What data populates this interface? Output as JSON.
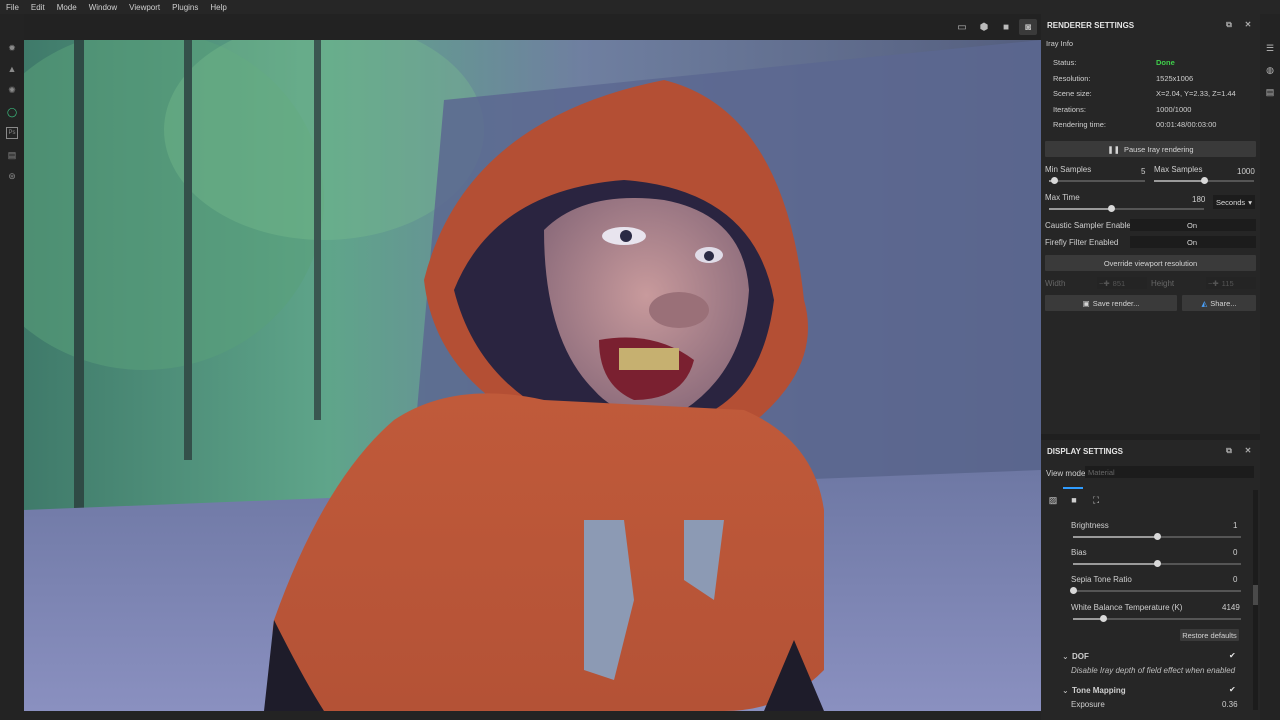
{
  "menu": [
    "File",
    "Edit",
    "Mode",
    "Window",
    "Viewport",
    "Plugins",
    "Help"
  ],
  "renderer": {
    "title": "RENDERER SETTINGS",
    "section": "Iray Info",
    "info": [
      {
        "label": "Status:",
        "value": "Done"
      },
      {
        "label": "Resolution:",
        "value": "1525x1006"
      },
      {
        "label": "Scene size:",
        "value": "X=2.04, Y=2.33, Z=1.44"
      },
      {
        "label": "Iterations:",
        "value": "1000/1000"
      },
      {
        "label": "Rendering time:",
        "value": "00:01:48/00:03:00"
      }
    ],
    "pause_label": "Pause Iray rendering",
    "min_samples_label": "Min Samples",
    "min_samples_value": "5",
    "min_samples_fraction": 0.05,
    "max_samples_label": "Max Samples",
    "max_samples_value": "1000",
    "max_samples_fraction": 0.5,
    "max_time_label": "Max Time",
    "max_time_value": "180",
    "max_time_fraction": 0.4,
    "time_unit": "Seconds",
    "caustic_label": "Caustic Sampler Enabled",
    "caustic_value": "On",
    "firefly_label": "Firefly Filter Enabled",
    "firefly_value": "On",
    "override_label": "Override viewport resolution",
    "width_label": "Width",
    "width_value": "851",
    "height_label": "Height",
    "height_value": "115",
    "save_label": "Save render...",
    "share_label": "Share...",
    "status_color": "#3ecf4a"
  },
  "display": {
    "title": "DISPLAY SETTINGS",
    "view_mode_label": "View mode",
    "view_mode_value": "Material",
    "brightness_label": "Brightness",
    "brightness_value": "1",
    "brightness_fraction": 0.5,
    "bias_label": "Bias",
    "bias_value": "0",
    "bias_fraction": 0.5,
    "sepia_label": "Sepia Tone Ratio",
    "sepia_value": "0",
    "sepia_fraction": 0.0,
    "wb_label": "White Balance Temperature (K)",
    "wb_value": "4149",
    "wb_fraction": 0.18,
    "restore_label": "Restore defaults",
    "dof_label": "DOF",
    "dof_desc": "Disable Iray depth of field effect when enabled",
    "tone_label": "Tone Mapping",
    "exposure_label": "Exposure",
    "exposure_value": "0.36"
  }
}
